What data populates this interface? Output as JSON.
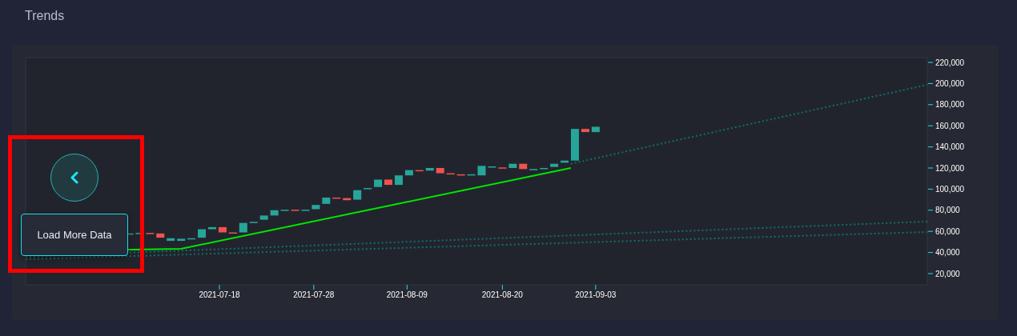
{
  "title": "Trends",
  "chart": {
    "y_axis_labels": [
      "220,000",
      "200,000",
      "180,000",
      "160,000",
      "140,000",
      "120,000",
      "100,000",
      "80,000",
      "60,000",
      "40,000",
      "20,000"
    ],
    "x_axis_labels": [
      "2021-07-18",
      "2021-07-28",
      "2021-08-09",
      "2021-08-20",
      "2021-09-03"
    ]
  },
  "overlay": {
    "load_more_button": {
      "label": "Load More Data"
    }
  }
}
